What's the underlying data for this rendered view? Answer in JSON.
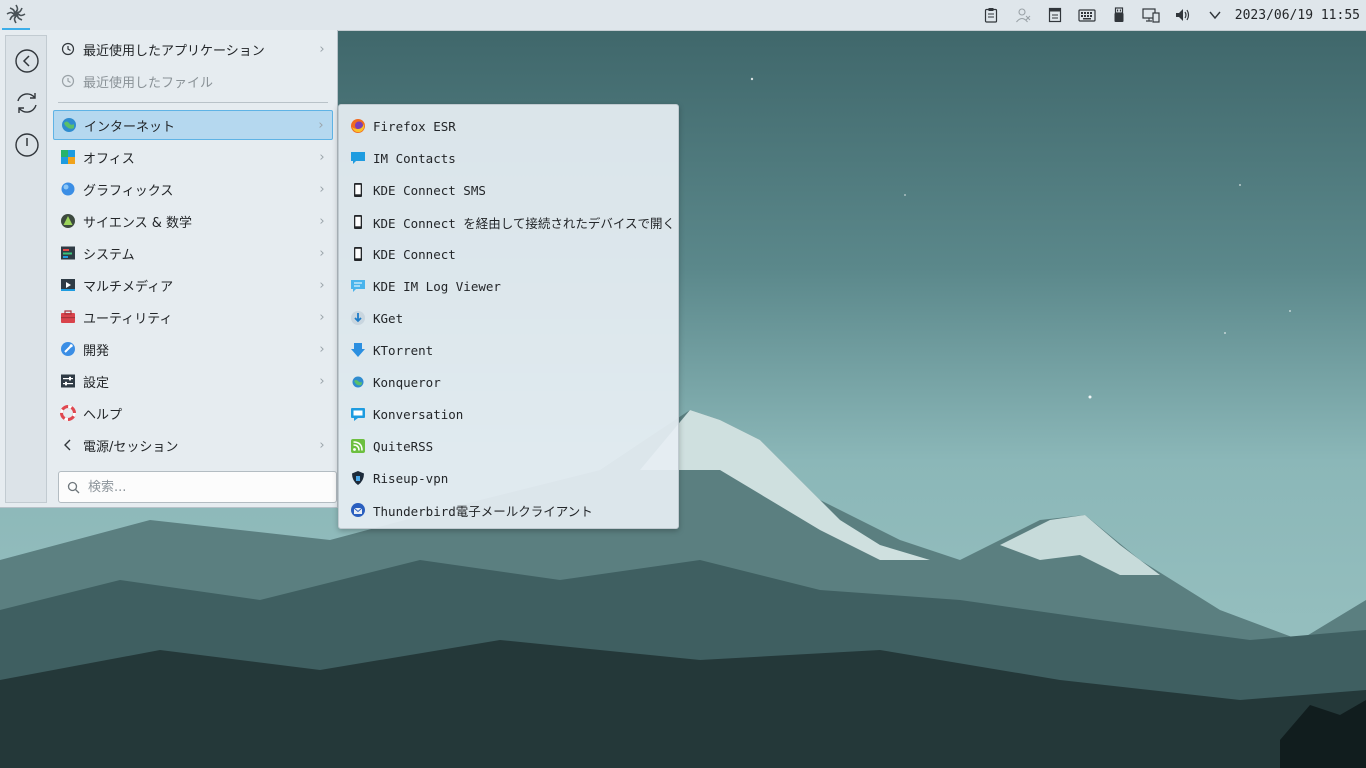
{
  "panel": {
    "clock": "2023/06/19 11:55",
    "tray_icons": [
      "clipboard-icon",
      "user-icon",
      "notes-icon",
      "keyboard-icon",
      "usb-drive-icon",
      "network-icon",
      "volume-icon",
      "expand-tray-icon"
    ]
  },
  "menu": {
    "sidebar": [
      "back-icon",
      "refresh-icon",
      "power-icon"
    ],
    "recent": [
      {
        "label": "最近使用したアプリケーション",
        "icon": "clock-icon",
        "dim": false
      },
      {
        "label": "最近使用したファイル",
        "icon": "clock-icon",
        "dim": true
      }
    ],
    "categories": [
      {
        "label": "インターネット",
        "icon": "internet-icon",
        "selected": true
      },
      {
        "label": "オフィス",
        "icon": "office-icon"
      },
      {
        "label": "グラフィックス",
        "icon": "graphics-icon"
      },
      {
        "label": "サイエンス & 数学",
        "icon": "science-icon"
      },
      {
        "label": "システム",
        "icon": "system-icon"
      },
      {
        "label": "マルチメディア",
        "icon": "multimedia-icon"
      },
      {
        "label": "ユーティリティ",
        "icon": "utilities-icon"
      },
      {
        "label": "開発",
        "icon": "development-icon"
      },
      {
        "label": "設定",
        "icon": "settings-icon"
      },
      {
        "label": "ヘルプ",
        "icon": "help-icon"
      },
      {
        "label": "電源/セッション",
        "icon": "chevron-left-icon"
      }
    ],
    "search_placeholder": "検索..."
  },
  "submenu": {
    "items": [
      {
        "label": "Firefox ESR",
        "icon": "firefox-icon"
      },
      {
        "label": "IM Contacts",
        "icon": "chat-icon"
      },
      {
        "label": "KDE Connect SMS",
        "icon": "phone-icon"
      },
      {
        "label": "KDE Connect を経由して接続されたデバイスで開く",
        "icon": "phone-icon"
      },
      {
        "label": "KDE Connect",
        "icon": "phone-icon"
      },
      {
        "label": "KDE IM Log Viewer",
        "icon": "log-viewer-icon"
      },
      {
        "label": "KGet",
        "icon": "kget-icon"
      },
      {
        "label": "KTorrent",
        "icon": "ktorrent-icon"
      },
      {
        "label": "Konqueror",
        "icon": "konqueror-icon"
      },
      {
        "label": "Konversation",
        "icon": "konversation-icon"
      },
      {
        "label": "QuiteRSS",
        "icon": "rss-icon"
      },
      {
        "label": "Riseup-vpn",
        "icon": "vpn-icon"
      },
      {
        "label": "Thunderbird電子メールクライアント",
        "icon": "thunderbird-icon"
      }
    ]
  }
}
